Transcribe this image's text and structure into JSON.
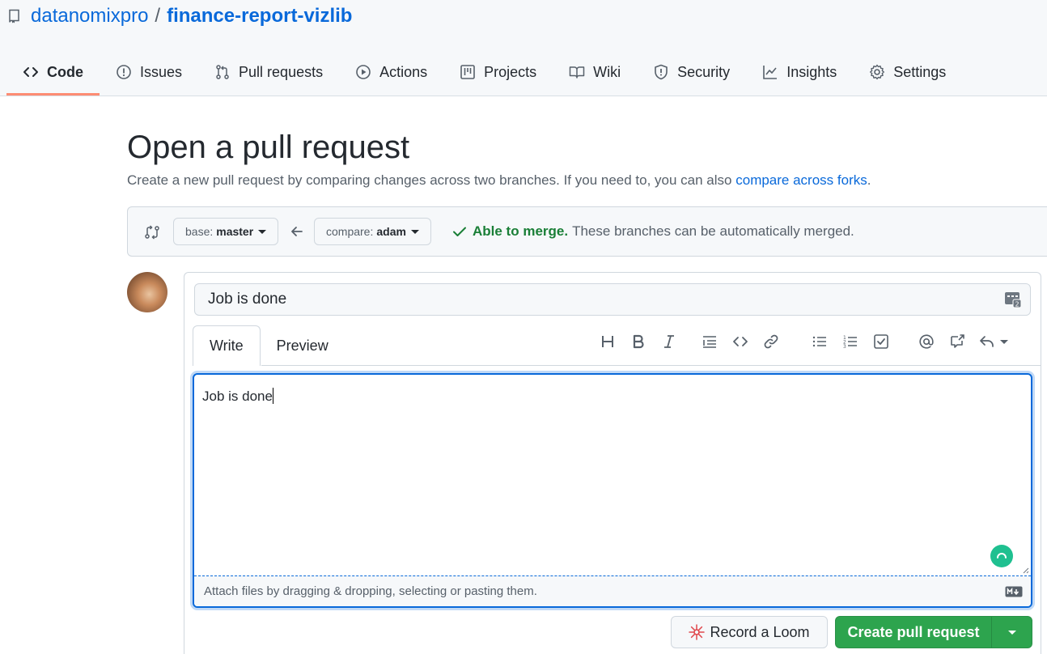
{
  "repo": {
    "owner": "datanomixpro",
    "separator": "/",
    "name": "finance-report-vizlib"
  },
  "nav": {
    "tabs": [
      {
        "label": "Code",
        "icon": "code-icon",
        "active": true
      },
      {
        "label": "Issues",
        "icon": "issue-icon"
      },
      {
        "label": "Pull requests",
        "icon": "pull-request-icon"
      },
      {
        "label": "Actions",
        "icon": "play-icon"
      },
      {
        "label": "Projects",
        "icon": "project-icon"
      },
      {
        "label": "Wiki",
        "icon": "book-icon"
      },
      {
        "label": "Security",
        "icon": "shield-icon"
      },
      {
        "label": "Insights",
        "icon": "graph-icon"
      },
      {
        "label": "Settings",
        "icon": "gear-icon"
      }
    ]
  },
  "page": {
    "title": "Open a pull request",
    "subtitle": "Create a new pull request by comparing changes across two branches. If you need to, you can also",
    "subtitle_link": "compare across forks",
    "subtitle_end": "."
  },
  "compare": {
    "base_prefix": "base:",
    "base_branch": "master",
    "compare_prefix": "compare:",
    "compare_branch": "adam",
    "merge_ok": "Able to merge.",
    "merge_text": "These branches can be automatically merged."
  },
  "form": {
    "title_value": "Job is done",
    "tabs": {
      "write": "Write",
      "preview": "Preview"
    },
    "body_value": "Job is done",
    "attach_hint": "Attach files by dragging & dropping, selecting or pasting them."
  },
  "actions": {
    "loom_label": "Record a Loom",
    "create_label": "Create pull request"
  },
  "colors": {
    "link": "#0969da",
    "success": "#1a7f37",
    "primary_button": "#2da44e",
    "active_tab_underline": "#fd8c73"
  }
}
